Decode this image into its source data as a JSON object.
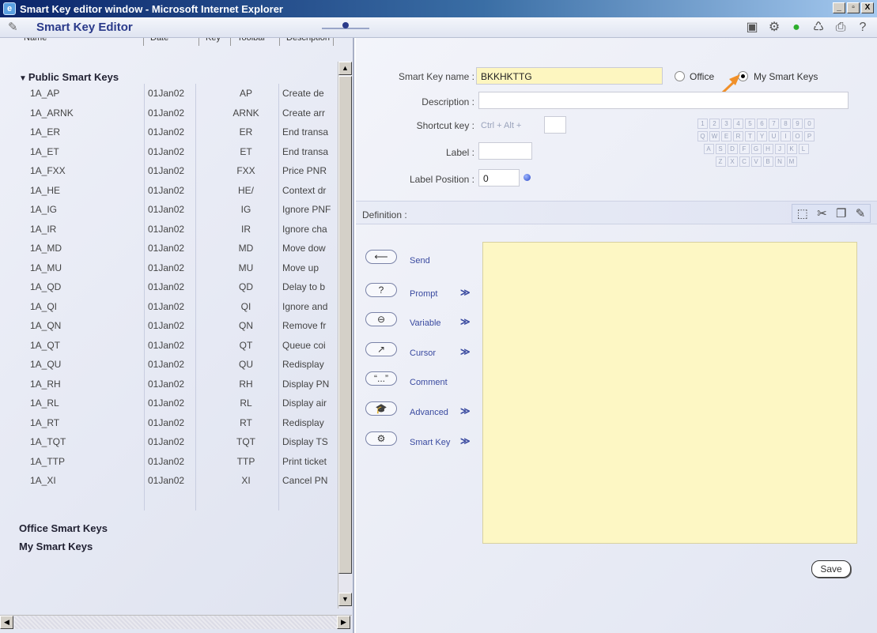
{
  "window": {
    "title": "Smart Key editor window - Microsoft Internet Explorer",
    "btn_min": "_",
    "btn_max": "▫",
    "btn_close": "X"
  },
  "app": {
    "title": "Smart Key Editor"
  },
  "tree": {
    "columns": [
      "Name",
      "Date",
      "Key",
      "Toolbar",
      "Description"
    ],
    "root_label": "Public Smart Keys",
    "rows": [
      {
        "name": "1A_AP",
        "date": "01Jan02",
        "key": "AP",
        "desc": "Create de"
      },
      {
        "name": "1A_ARNK",
        "date": "01Jan02",
        "key": "ARNK",
        "desc": "Create arr"
      },
      {
        "name": "1A_ER",
        "date": "01Jan02",
        "key": "ER",
        "desc": "End transa"
      },
      {
        "name": "1A_ET",
        "date": "01Jan02",
        "key": "ET",
        "desc": "End transa"
      },
      {
        "name": "1A_FXX",
        "date": "01Jan02",
        "key": "FXX",
        "desc": "Price PNR"
      },
      {
        "name": "1A_HE",
        "date": "01Jan02",
        "key": "HE/",
        "desc": "Context dr"
      },
      {
        "name": "1A_IG",
        "date": "01Jan02",
        "key": "IG",
        "desc": "Ignore PNF"
      },
      {
        "name": "1A_IR",
        "date": "01Jan02",
        "key": "IR",
        "desc": "Ignore cha"
      },
      {
        "name": "1A_MD",
        "date": "01Jan02",
        "key": "MD",
        "desc": "Move dow"
      },
      {
        "name": "1A_MU",
        "date": "01Jan02",
        "key": "MU",
        "desc": "Move up"
      },
      {
        "name": "1A_QD",
        "date": "01Jan02",
        "key": "QD",
        "desc": "Delay to b"
      },
      {
        "name": "1A_QI",
        "date": "01Jan02",
        "key": "QI",
        "desc": "Ignore and"
      },
      {
        "name": "1A_QN",
        "date": "01Jan02",
        "key": "QN",
        "desc": "Remove fr"
      },
      {
        "name": "1A_QT",
        "date": "01Jan02",
        "key": "QT",
        "desc": "Queue coi"
      },
      {
        "name": "1A_QU",
        "date": "01Jan02",
        "key": "QU",
        "desc": "Redisplay"
      },
      {
        "name": "1A_RH",
        "date": "01Jan02",
        "key": "RH",
        "desc": "Display PN"
      },
      {
        "name": "1A_RL",
        "date": "01Jan02",
        "key": "RL",
        "desc": "Display air"
      },
      {
        "name": "1A_RT",
        "date": "01Jan02",
        "key": "RT",
        "desc": "Redisplay"
      },
      {
        "name": "1A_TQT",
        "date": "01Jan02",
        "key": "TQT",
        "desc": "Display TS"
      },
      {
        "name": "1A_TTP",
        "date": "01Jan02",
        "key": "TTP",
        "desc": "Print ticket"
      },
      {
        "name": "1A_XI",
        "date": "01Jan02",
        "key": "XI",
        "desc": "Cancel PN"
      }
    ],
    "office_label": "Office Smart Keys",
    "my_label": "My Smart Keys"
  },
  "form": {
    "name_label": "Smart Key name :",
    "name_value": "BKKHKTTG",
    "radio_office": "Office",
    "radio_my": "My Smart Keys",
    "desc_label": "Description :",
    "desc_value": "",
    "shortcut_label": "Shortcut key :",
    "shortcut_hint": "Ctrl + Alt +",
    "label_label": "Label :",
    "label_value": "",
    "labelpos_label": "Label Position :",
    "labelpos_value": "0",
    "keyboard": [
      [
        "1",
        "2",
        "3",
        "4",
        "5",
        "6",
        "7",
        "8",
        "9",
        "0"
      ],
      [
        "Q",
        "W",
        "E",
        "R",
        "T",
        "Y",
        "U",
        "I",
        "O",
        "P"
      ],
      [
        "A",
        "S",
        "D",
        "F",
        "G",
        "H",
        "J",
        "K",
        "L"
      ],
      [
        "Z",
        "X",
        "C",
        "V",
        "B",
        "N",
        "M"
      ]
    ]
  },
  "definition": {
    "label": "Definition :",
    "commands": [
      {
        "pill": "⟵",
        "text": "Send",
        "chev": ""
      },
      {
        "pill": "?",
        "text": "Prompt",
        "chev": "≫"
      },
      {
        "pill": "⊖",
        "text": "Variable",
        "chev": "≫"
      },
      {
        "pill": "↗",
        "text": "Cursor",
        "chev": "≫"
      },
      {
        "pill": "“...”",
        "text": "Comment",
        "chev": ""
      },
      {
        "pill": "🎓",
        "text": "Advanced",
        "chev": "≫"
      },
      {
        "pill": "⚙",
        "text": "Smart Key",
        "chev": "≫"
      }
    ],
    "save_label": "Save"
  },
  "colors": {
    "accent_orange": "#f0902a",
    "field_yellow": "#fdf6c0",
    "title_blue": "#0a246a"
  }
}
